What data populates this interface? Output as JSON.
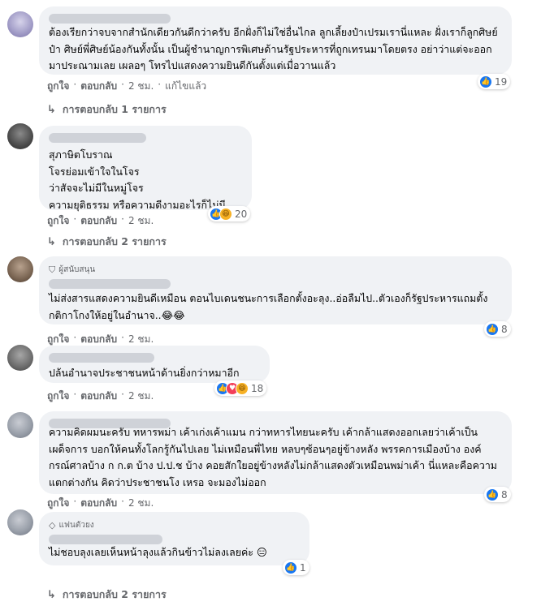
{
  "comments": [
    {
      "badge": "",
      "text": "ต้องเรียกว่าจบจากสำนักเดียวกันดีกว่าครับ อีกฝั่งก็ไม่ใช่อื่นไกล ลูกเลี้ยงป๋าเปรมเรานี่แหละ ฝั่งเราก็ลูกศิษย์ป๋า ศิษย์พี่ศิษย์น้องกันทั้งนั้น เป็นผู้ชำนาญการพิเศษด้านรัฐประหารที่ถูกเทรนมาโดยตรง อย่าว่าแต่จะออกมาประณามเลย เผลอๆ โทรไปแสดงความยินดีกันตั้งแต่เมื่อวานแล้ว",
      "reaction_icons": [
        "like-icon"
      ],
      "reaction_count": "19",
      "like": "ถูกใจ",
      "reply": "ตอบกลับ",
      "time": "2 ชม.",
      "edited": "แก้ไขแล้ว",
      "replies_label": "การตอบกลับ 1 รายการ"
    },
    {
      "badge": "",
      "text": "สุภาษิตโบราณ\nโจรย่อมเข้าใจในโจร\nว่าสัจจะไม่มีในหมู่โจร\nความยุติธรรม หรือความดีงามอะไรก็ไม่มี",
      "reaction_icons": [
        "like-icon",
        "haha-icon"
      ],
      "reaction_count": "20",
      "like": "ถูกใจ",
      "reply": "ตอบกลับ",
      "time": "2 ชม.",
      "edited": "",
      "replies_label": "การตอบกลับ 2 รายการ"
    },
    {
      "badge": "ผู้สนับสนุน",
      "text": "ไม่ส่งสารแสดงความยินดีเหมือน ตอนไบเดนชนะการเลือกตั้งอะลุง..อ่อลืมไป..ตัวเองก็รัฐประหารแถมตั้งกติกาโกงให้อยู่ในอำนาจ..😂😂",
      "reaction_icons": [
        "like-icon"
      ],
      "reaction_count": "8",
      "like": "ถูกใจ",
      "reply": "ตอบกลับ",
      "time": "2 ชม.",
      "edited": "",
      "replies_label": ""
    },
    {
      "badge": "",
      "text": "ปล้นอำนาจประชาชนหน้าด้านยิ่งกว่าหมาอีก",
      "reaction_icons": [
        "like-icon",
        "love-icon",
        "haha-icon"
      ],
      "reaction_count": "18",
      "like": "ถูกใจ",
      "reply": "ตอบกลับ",
      "time": "2 ชม.",
      "edited": "",
      "replies_label": ""
    },
    {
      "badge": "",
      "text": "ความคิดผมนะครับ ทหารพม่า เค้าเก่งเค้าแมน กว่าทหารไทยนะครับ เค้ากล้าแสดงออกเลยว่าเค้าเป็นเผด็จการ บอกให้คนทั้งโลกรู้กันไปเลย ไม่เหมือนพี่ไทย หลบๆซ้อนๆอยู่ข้างหลัง พรรคการเมืองบ้าง องค์กรณ์ศาลบ้าง ก ก.ต บ้าง ป.ป.ช บ้าง คอยสักใยอยู่ข้างหลังไม่กล้าแสดงตัวเหมือนพม่าเค้า นี่แหละคือความแตกต่างกัน คิดว่าประชาชนโง เหรอ จะมองไม่ออก",
      "reaction_icons": [
        "like-icon"
      ],
      "reaction_count": "8",
      "like": "ถูกใจ",
      "reply": "ตอบกลับ",
      "time": "2 ชม.",
      "edited": "",
      "replies_label": ""
    },
    {
      "badge": "แฟนตัวยง",
      "text": "ไม่ชอบลุงเลยเห็นหน้าลุงแล้วกินข้าวไม่ลงเลยค่ะ 😑",
      "reaction_icons": [
        "like-icon"
      ],
      "reaction_count": "1",
      "like": "",
      "reply": "",
      "time": "",
      "edited": "",
      "replies_label": "การตอบกลับ 2 รายการ"
    }
  ]
}
